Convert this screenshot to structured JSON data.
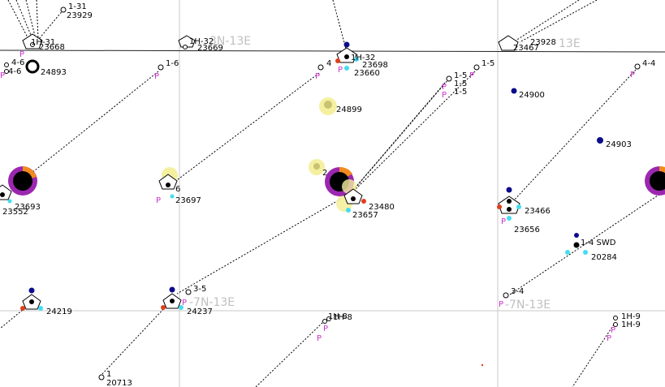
{
  "section_labels": [
    "3N-13E",
    "13E",
    "-7N-13E",
    "-7N-13E"
  ],
  "well_labels": [
    "1-31",
    "23929",
    "1H-31",
    "23668",
    "1H-32",
    "23669",
    "1H-32",
    "23698",
    "23660",
    "4-6",
    "4-6",
    "24893",
    "1-6",
    "4",
    "1-5",
    "1-5",
    "1-5",
    "1-5",
    "23928",
    "23467",
    "4-4",
    "24899",
    "24900",
    "24903",
    "23693",
    "23552",
    "6",
    "23697",
    "23480",
    "23657",
    "23466",
    "23656",
    "1-4 SWD",
    "20284",
    "24219",
    "3-5",
    "24237",
    "1H-8",
    "1H-8",
    "3-4",
    "1H-9",
    "1H-9",
    "1",
    "20713",
    "2"
  ],
  "p_marker": "P",
  "colors": {
    "grid": "#c8c8c8",
    "township_line": "#222222",
    "trajectory": "#000000",
    "bhl_marker": "#cc33cc",
    "well_blue": "#0b0b8c",
    "well_red": "#e0401a",
    "well_cyan": "#44ddee",
    "bubble_orange": "#f28a1e",
    "bubble_purple": "#9b27b0",
    "bubble_yellow": "#f4f0a0"
  }
}
